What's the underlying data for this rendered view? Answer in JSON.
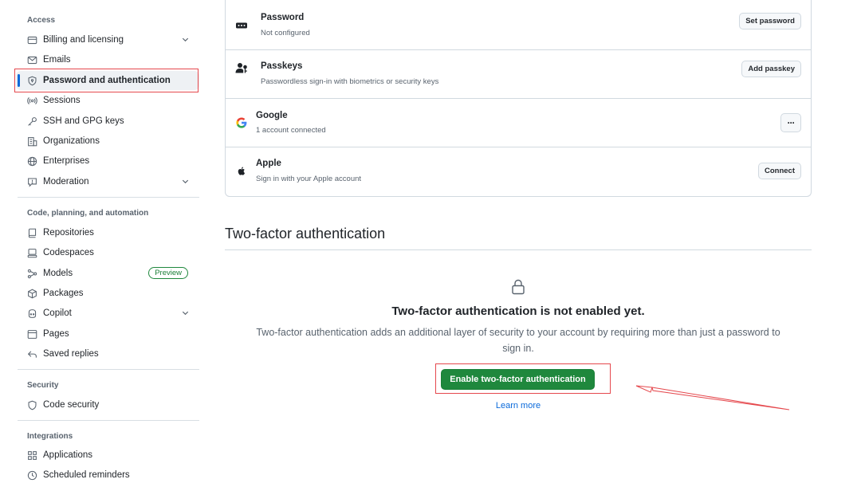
{
  "sidebar": {
    "sections": {
      "access": "Access",
      "code": "Code, planning, and automation",
      "security": "Security",
      "integrations": "Integrations"
    },
    "items": {
      "billing": "Billing and licensing",
      "emails": "Emails",
      "password": "Password and authentication",
      "sessions": "Sessions",
      "ssh": "SSH and GPG keys",
      "organizations": "Organizations",
      "enterprises": "Enterprises",
      "moderation": "Moderation",
      "repositories": "Repositories",
      "codespaces": "Codespaces",
      "models": "Models",
      "packages": "Packages",
      "copilot": "Copilot",
      "pages": "Pages",
      "saved_replies": "Saved replies",
      "code_security": "Code security",
      "applications": "Applications",
      "scheduled_reminders": "Scheduled reminders"
    },
    "preview_badge": "Preview"
  },
  "auth_methods": {
    "password": {
      "title": "Password",
      "subtitle": "Not configured",
      "button": "Set password"
    },
    "passkeys": {
      "title": "Passkeys",
      "subtitle": "Passwordless sign-in with biometrics or security keys",
      "button": "Add passkey"
    },
    "google": {
      "title": "Google",
      "subtitle": "1 account connected",
      "button": "···"
    },
    "apple": {
      "title": "Apple",
      "subtitle": "Sign in with your Apple account",
      "button": "Connect"
    }
  },
  "two_factor": {
    "heading": "Two-factor authentication",
    "title": "Two-factor authentication is not enabled yet.",
    "description": "Two-factor authentication adds an additional layer of security to your account by requiring more than just a password to sign in.",
    "enable_button": "Enable two-factor authentication",
    "learn_more": "Learn more"
  },
  "colors": {
    "accent_green": "#1f883d",
    "link_blue": "#0969da",
    "annotation_red": "#e5484d",
    "active_bar": "#0969da"
  }
}
